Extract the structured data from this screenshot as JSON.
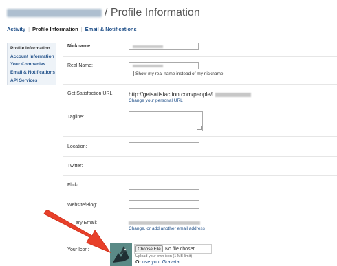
{
  "header": {
    "title": "/ Profile Information"
  },
  "subnav": {
    "items": [
      "Activity",
      "Profile Information",
      "Email & Notifications"
    ],
    "separator": "|"
  },
  "sidebar": {
    "items": [
      "Profile Information",
      "Account Information",
      "Your Companies",
      "Email & Notifications",
      "API Services"
    ]
  },
  "form": {
    "nickname_label": "Nickname:",
    "realname_label": "Real Name:",
    "show_real_name_label": "Show my real name instead of my nickname",
    "gs_url_label": "Get Satisfaction URL:",
    "gs_url_value": "http://getsatisfaction.com/people/l",
    "change_url_link": "Change your personal URL",
    "tagline_label": "Tagline:",
    "location_label": "Location:",
    "twitter_label": "Twitter:",
    "flickr_label": "Flickr:",
    "website_label": "Website/Blog:",
    "email_label": "ary Email:",
    "change_email_link": "Change, or add another email address",
    "icon_label": "Your Icon:",
    "choose_file": "Choose File",
    "no_file": "No file chosen",
    "upload_hint": "Upload your own icon (1 MB limit)",
    "or_text": "Or",
    "gravatar_link": "use your Gravatar"
  },
  "colors": {
    "link": "#1f4f88",
    "arrow": "#e8402a",
    "sidebar_bg": "#eef3f8"
  }
}
